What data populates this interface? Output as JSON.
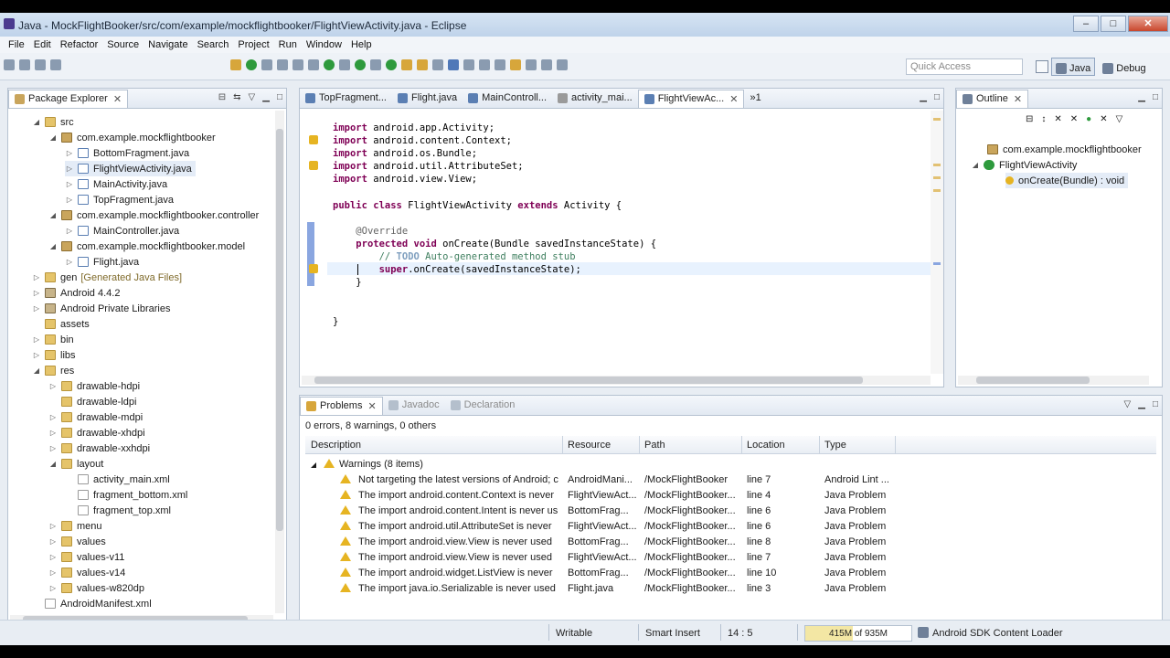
{
  "window": {
    "title": "Java - MockFlightBooker/src/com/example/mockflightbooker/FlightViewActivity.java - Eclipse"
  },
  "menu": [
    "File",
    "Edit",
    "Refactor",
    "Source",
    "Navigate",
    "Search",
    "Project",
    "Run",
    "Window",
    "Help"
  ],
  "toolbar": {
    "quick_access_placeholder": "Quick Access",
    "perspectives": [
      {
        "label": "Java",
        "icon": "java-perspective-icon",
        "active": true
      },
      {
        "label": "Debug",
        "icon": "debug-perspective-icon",
        "active": false
      }
    ]
  },
  "package_explorer": {
    "title": "Package Explorer",
    "items": [
      {
        "label": "src",
        "icon": "folder",
        "twisty": "open",
        "depth": 2
      },
      {
        "label": "com.example.mockflightbooker",
        "icon": "pkg",
        "twisty": "open",
        "depth": 3
      },
      {
        "label": "BottomFragment.java",
        "icon": "java",
        "twisty": "closed",
        "depth": 4
      },
      {
        "label": "FlightViewActivity.java",
        "icon": "java",
        "twisty": "closed",
        "depth": 4,
        "selected": true
      },
      {
        "label": "MainActivity.java",
        "icon": "java",
        "twisty": "closed",
        "depth": 4
      },
      {
        "label": "TopFragment.java",
        "icon": "java",
        "twisty": "closed",
        "depth": 4
      },
      {
        "label": "com.example.mockflightbooker.controller",
        "icon": "pkg",
        "twisty": "open",
        "depth": 3
      },
      {
        "label": "MainController.java",
        "icon": "java",
        "twisty": "closed",
        "depth": 4
      },
      {
        "label": "com.example.mockflightbooker.model",
        "icon": "pkg",
        "twisty": "open",
        "depth": 3
      },
      {
        "label": "Flight.java",
        "icon": "java",
        "twisty": "closed",
        "depth": 4
      },
      {
        "label": "gen",
        "decoration": "[Generated Java Files]",
        "icon": "folder",
        "twisty": "closed",
        "depth": 2
      },
      {
        "label": "Android 4.4.2",
        "icon": "lib",
        "twisty": "closed",
        "depth": 2
      },
      {
        "label": "Android Private Libraries",
        "icon": "lib",
        "twisty": "closed",
        "depth": 2
      },
      {
        "label": "assets",
        "icon": "folder",
        "twisty": "",
        "depth": 2
      },
      {
        "label": "bin",
        "icon": "folder",
        "twisty": "closed",
        "depth": 2
      },
      {
        "label": "libs",
        "icon": "folder",
        "twisty": "closed",
        "depth": 2
      },
      {
        "label": "res",
        "icon": "folder",
        "twisty": "open",
        "depth": 2
      },
      {
        "label": "drawable-hdpi",
        "icon": "folder",
        "twisty": "closed",
        "depth": 3
      },
      {
        "label": "drawable-ldpi",
        "icon": "folder",
        "twisty": "",
        "depth": 3
      },
      {
        "label": "drawable-mdpi",
        "icon": "folder",
        "twisty": "closed",
        "depth": 3
      },
      {
        "label": "drawable-xhdpi",
        "icon": "folder",
        "twisty": "closed",
        "depth": 3
      },
      {
        "label": "drawable-xxhdpi",
        "icon": "folder",
        "twisty": "closed",
        "depth": 3
      },
      {
        "label": "layout",
        "icon": "folder",
        "twisty": "open",
        "depth": 3
      },
      {
        "label": "activity_main.xml",
        "icon": "xml",
        "twisty": "",
        "depth": 4
      },
      {
        "label": "fragment_bottom.xml",
        "icon": "xml",
        "twisty": "",
        "depth": 4
      },
      {
        "label": "fragment_top.xml",
        "icon": "xml",
        "twisty": "",
        "depth": 4
      },
      {
        "label": "menu",
        "icon": "folder",
        "twisty": "closed",
        "depth": 3
      },
      {
        "label": "values",
        "icon": "folder",
        "twisty": "closed",
        "depth": 3
      },
      {
        "label": "values-v11",
        "icon": "folder",
        "twisty": "closed",
        "depth": 3
      },
      {
        "label": "values-v14",
        "icon": "folder",
        "twisty": "closed",
        "depth": 3
      },
      {
        "label": "values-w820dp",
        "icon": "folder",
        "twisty": "closed",
        "depth": 3
      },
      {
        "label": "AndroidManifest.xml",
        "icon": "xml",
        "twisty": "",
        "depth": 2
      }
    ]
  },
  "editor": {
    "tabs": [
      {
        "label": "TopFragment...",
        "active": false
      },
      {
        "label": "Flight.java",
        "active": false
      },
      {
        "label": "MainControll...",
        "active": false
      },
      {
        "label": "activity_mai...",
        "active": false
      },
      {
        "label": "FlightViewAc...",
        "active": true
      },
      {
        "label": "»1",
        "active": false
      }
    ],
    "lines": [
      [
        [
          "kw",
          "import"
        ],
        [
          "",
          " android.app.Activity;"
        ]
      ],
      [
        [
          "kw",
          "import"
        ],
        [
          "",
          " android.content.Context;"
        ]
      ],
      [
        [
          "kw",
          "import"
        ],
        [
          "",
          " android.os.Bundle;"
        ]
      ],
      [
        [
          "kw",
          "import"
        ],
        [
          "",
          " android.util.AttributeSet;"
        ]
      ],
      [
        [
          "kw",
          "import"
        ],
        [
          "",
          " android.view.View;"
        ]
      ],
      [],
      [
        [
          "kw",
          "public class"
        ],
        [
          "",
          " FlightViewActivity "
        ],
        [
          "kw",
          "extends"
        ],
        [
          "",
          " Activity {"
        ]
      ],
      [],
      [
        [
          "",
          "    "
        ],
        [
          "ann",
          "@Override"
        ]
      ],
      [
        [
          "",
          "    "
        ],
        [
          "kw",
          "protected void"
        ],
        [
          "",
          " onCreate(Bundle savedInstanceState) {"
        ]
      ],
      [
        [
          "",
          "        "
        ],
        [
          "cmt",
          "// "
        ],
        [
          "todo",
          "TODO"
        ],
        [
          "cmt",
          " Auto-generated method stub"
        ]
      ],
      [
        [
          "",
          "        "
        ],
        [
          "kw",
          "super"
        ],
        [
          "",
          ".onCreate(savedInstanceState);"
        ]
      ],
      [
        [
          "",
          "    }"
        ]
      ],
      [],
      [],
      [
        [
          "",
          "}"
        ]
      ]
    ]
  },
  "outline": {
    "title": "Outline",
    "items": [
      {
        "label": "com.example.mockflightbooker",
        "depth": 1
      },
      {
        "label": "FlightViewActivity",
        "depth": 1,
        "twisty": "open"
      },
      {
        "label": "onCreate(Bundle) : void",
        "depth": 2,
        "selected": true
      }
    ]
  },
  "problems": {
    "tabs": [
      "Problems",
      "Javadoc",
      "Declaration"
    ],
    "summary": "0 errors, 8 warnings, 0 others",
    "columns": [
      "Description",
      "Resource",
      "Path",
      "Location",
      "Type"
    ],
    "group": "Warnings (8 items)",
    "rows": [
      [
        "Not targeting the latest versions of Android; c",
        "AndroidMani...",
        "/MockFlightBooker",
        "line 7",
        "Android Lint ..."
      ],
      [
        "The import android.content.Context is never",
        "FlightViewAct...",
        "/MockFlightBooker...",
        "line 4",
        "Java Problem"
      ],
      [
        "The import android.content.Intent is never us",
        "BottomFrag...",
        "/MockFlightBooker...",
        "line 6",
        "Java Problem"
      ],
      [
        "The import android.util.AttributeSet is never",
        "FlightViewAct...",
        "/MockFlightBooker...",
        "line 6",
        "Java Problem"
      ],
      [
        "The import android.view.View is never used",
        "BottomFrag...",
        "/MockFlightBooker...",
        "line 8",
        "Java Problem"
      ],
      [
        "The import android.view.View is never used",
        "FlightViewAct...",
        "/MockFlightBooker...",
        "line 7",
        "Java Problem"
      ],
      [
        "The import android.widget.ListView is never",
        "BottomFrag...",
        "/MockFlightBooker...",
        "line 10",
        "Java Problem"
      ],
      [
        "The import java.io.Serializable is never used",
        "Flight.java",
        "/MockFlightBooker...",
        "line 3",
        "Java Problem"
      ]
    ]
  },
  "status_bar": {
    "writable": "Writable",
    "insert_mode": "Smart Insert",
    "position": "14 : 5",
    "heap": "415M of 935M",
    "heap_used_fraction": 0.444,
    "job": "Android SDK Content Loader"
  },
  "colors": {
    "accent": "#7f0055",
    "comment": "#3f7f5f",
    "warning": "#e6b422"
  }
}
